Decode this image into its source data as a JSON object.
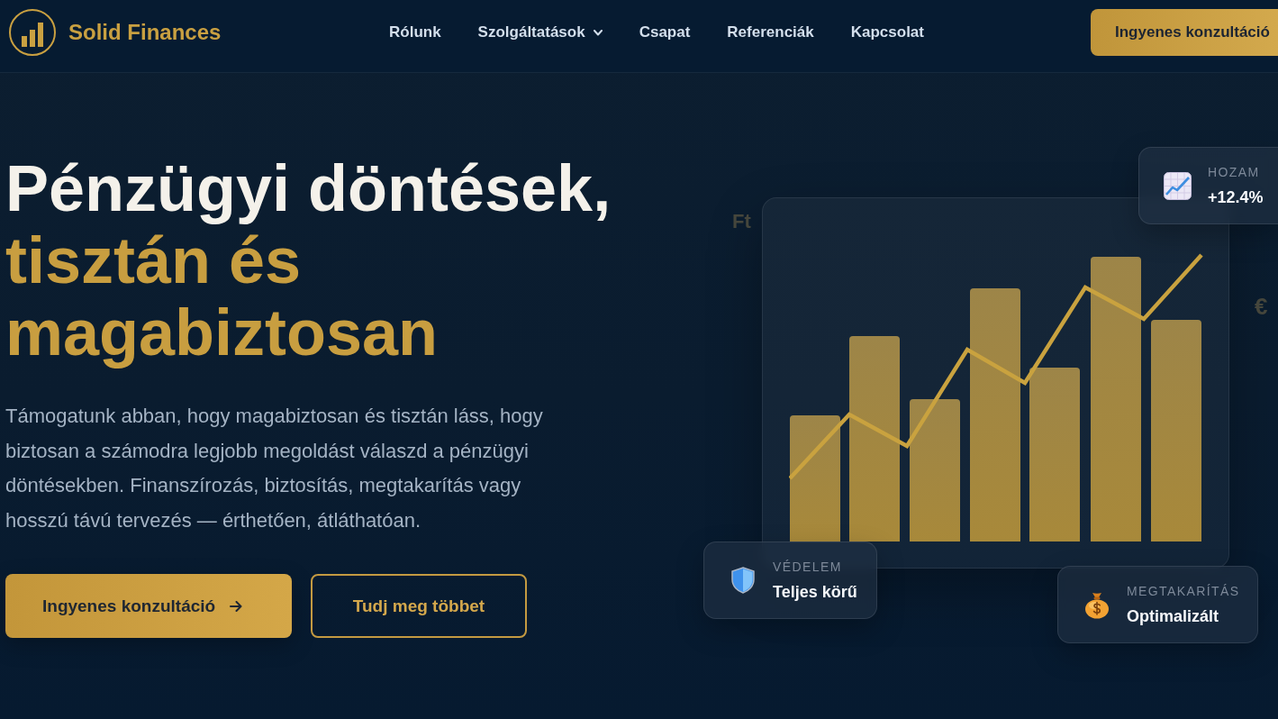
{
  "header": {
    "brand": "Solid Finances",
    "nav": [
      {
        "label": "Rólunk",
        "dropdown": false
      },
      {
        "label": "Szolgáltatások",
        "dropdown": true
      },
      {
        "label": "Csapat",
        "dropdown": false
      },
      {
        "label": "Referenciák",
        "dropdown": false
      },
      {
        "label": "Kapcsolat",
        "dropdown": false
      }
    ],
    "cta": "Ingyenes konzultáció"
  },
  "hero": {
    "title": "Pénzügyi döntések,",
    "title_highlight": "tisztán és magabiztosan",
    "description": "Támogatunk abban, hogy magabiztosan és tisztán láss, hogy biztosan a számodra legjobb megoldást válaszd a pénzügyi döntésekben. Finanszírozás, biztosítás, megtakarítás vagy hosszú távú tervezés — érthetően, átláthatóan.",
    "buttons": [
      {
        "label": "Ingyenes konzultáció",
        "kind": "primary"
      },
      {
        "label": "Tudj meg többet",
        "kind": "outline"
      }
    ]
  },
  "visual": {
    "currency_symbols": [
      "Ft",
      "€"
    ],
    "stats": [
      {
        "kind": "yield",
        "label": "HOZAM",
        "value": "+12.4%"
      },
      {
        "kind": "protection",
        "label": "VÉDELEM",
        "value": "Teljes körű"
      },
      {
        "kind": "savings",
        "label": "MEGTAKARÍTÁS",
        "value": "Optimalizált"
      }
    ]
  }
}
